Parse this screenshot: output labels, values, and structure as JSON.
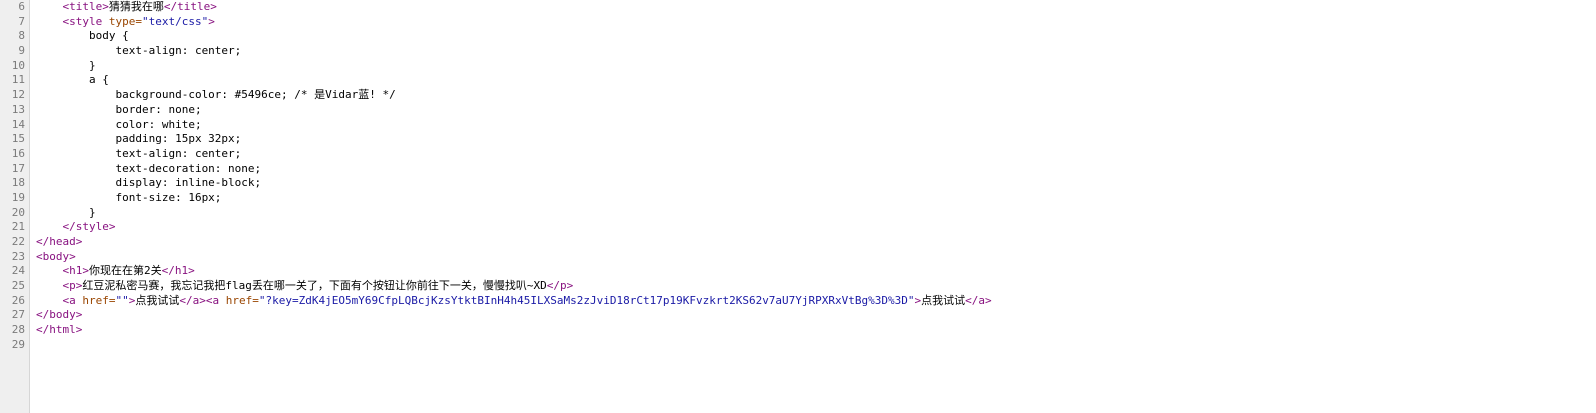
{
  "colors": {
    "tag": "#881280",
    "attribute": "#994500",
    "value": "#1a1aa6",
    "text": "#000000",
    "gutter_bg": "#efefef",
    "line_number": "#7a7a7a"
  },
  "lines": [
    {
      "n": "6",
      "parts": [
        {
          "t": "    ",
          "c": "text"
        },
        {
          "t": "<title>",
          "c": "tag"
        },
        {
          "t": "猜猜我在哪",
          "c": "text"
        },
        {
          "t": "</title>",
          "c": "tag"
        }
      ]
    },
    {
      "n": "7",
      "parts": [
        {
          "t": "    ",
          "c": "text"
        },
        {
          "t": "<style ",
          "c": "tag"
        },
        {
          "t": "type=",
          "c": "attr"
        },
        {
          "t": "\"text/css\"",
          "c": "val"
        },
        {
          "t": ">",
          "c": "tag"
        }
      ]
    },
    {
      "n": "8",
      "parts": [
        {
          "t": "        body {",
          "c": "text"
        }
      ]
    },
    {
      "n": "9",
      "parts": [
        {
          "t": "            text-align: center;",
          "c": "text"
        }
      ]
    },
    {
      "n": "10",
      "parts": [
        {
          "t": "        }",
          "c": "text"
        }
      ]
    },
    {
      "n": "11",
      "parts": [
        {
          "t": "        a {",
          "c": "text"
        }
      ]
    },
    {
      "n": "12",
      "parts": [
        {
          "t": "            background-color: #5496ce; /* 是Vidar蓝! */",
          "c": "text"
        }
      ]
    },
    {
      "n": "13",
      "parts": [
        {
          "t": "            border: none;",
          "c": "text"
        }
      ]
    },
    {
      "n": "14",
      "parts": [
        {
          "t": "            color: white;",
          "c": "text"
        }
      ]
    },
    {
      "n": "15",
      "parts": [
        {
          "t": "            padding: 15px 32px;",
          "c": "text"
        }
      ]
    },
    {
      "n": "16",
      "parts": [
        {
          "t": "            text-align: center;",
          "c": "text"
        }
      ]
    },
    {
      "n": "17",
      "parts": [
        {
          "t": "            text-decoration: none;",
          "c": "text"
        }
      ]
    },
    {
      "n": "18",
      "parts": [
        {
          "t": "            display: inline-block;",
          "c": "text"
        }
      ]
    },
    {
      "n": "19",
      "parts": [
        {
          "t": "            font-size: 16px;",
          "c": "text"
        }
      ]
    },
    {
      "n": "20",
      "parts": [
        {
          "t": "        }",
          "c": "text"
        }
      ]
    },
    {
      "n": "21",
      "parts": [
        {
          "t": "    ",
          "c": "text"
        },
        {
          "t": "</style>",
          "c": "tag"
        }
      ]
    },
    {
      "n": "22",
      "parts": [
        {
          "t": "</head>",
          "c": "tag"
        }
      ]
    },
    {
      "n": "23",
      "parts": [
        {
          "t": "<body>",
          "c": "tag"
        }
      ]
    },
    {
      "n": "24",
      "parts": [
        {
          "t": "    ",
          "c": "text"
        },
        {
          "t": "<h1>",
          "c": "tag"
        },
        {
          "t": "你现在在第2关",
          "c": "text"
        },
        {
          "t": "</h1>",
          "c": "tag"
        }
      ]
    },
    {
      "n": "25",
      "parts": [
        {
          "t": "    ",
          "c": "text"
        },
        {
          "t": "<p>",
          "c": "tag"
        },
        {
          "t": "红豆泥私密马赛，我忘记我把flag丢在哪一关了，下面有个按钮让你前往下一关，慢慢找叭~XD",
          "c": "text"
        },
        {
          "t": "</p>",
          "c": "tag"
        }
      ]
    },
    {
      "n": "26",
      "parts": [
        {
          "t": "    ",
          "c": "text"
        },
        {
          "t": "<a ",
          "c": "tag"
        },
        {
          "t": "href=",
          "c": "attr"
        },
        {
          "t": "\"\"",
          "c": "val"
        },
        {
          "t": ">",
          "c": "tag"
        },
        {
          "t": "点我试试",
          "c": "text"
        },
        {
          "t": "</a>",
          "c": "tag"
        },
        {
          "t": "<a ",
          "c": "tag"
        },
        {
          "t": "href=",
          "c": "attr"
        },
        {
          "t": "\"?key=ZdK4jEO5mY69CfpLQBcjKzsYtktBInH4h45ILXSaMs2zJviD18rCt17p19KFvzkrt2KS62v7aU7YjRPXRxVtBg%3D%3D\"",
          "c": "val"
        },
        {
          "t": ">",
          "c": "tag"
        },
        {
          "t": "点我试试",
          "c": "text"
        },
        {
          "t": "</a>",
          "c": "tag"
        }
      ]
    },
    {
      "n": "27",
      "parts": [
        {
          "t": "</body>",
          "c": "tag"
        }
      ]
    },
    {
      "n": "28",
      "parts": [
        {
          "t": "</html>",
          "c": "tag"
        }
      ]
    },
    {
      "n": "29",
      "parts": []
    }
  ]
}
